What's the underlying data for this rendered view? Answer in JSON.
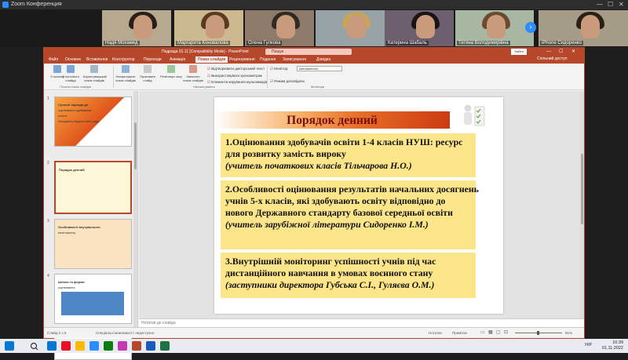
{
  "zoom": {
    "window_title": "Zoom Конференция",
    "participants": [
      {
        "name": "Надя Мохамед",
        "bg": "#b7a890",
        "hair": "#2a1e18"
      },
      {
        "name": "Маргарита Коновалова",
        "bg": "#cdb98f",
        "hair": "#5a3a22"
      },
      {
        "name": "Олена Гулкова",
        "bg": "#8d7a6a",
        "hair": "#2f2a24"
      },
      {
        "name": "",
        "bg": "#98a3a8",
        "hair": "#c8a35a"
      },
      {
        "name": "Катерина Шабаль",
        "bg": "#6c5f6e",
        "hair": "#1a1414"
      },
      {
        "name": "Тетяна Володимирівна",
        "bg": "#a7b7a1",
        "hair": "#6b4a30"
      },
      {
        "name": "iPhone Сидоренко",
        "bg": "#a49c86",
        "hair": "#2b2018"
      }
    ]
  },
  "ppt": {
    "title": "Педрада 01.11 [Compatibility Mode] - PowerPoint",
    "search_placeholder": "Пошук",
    "signin": "Увійти",
    "share": "Спільний доступ",
    "tabs": [
      "Файл",
      "Основне",
      "Вставлення",
      "Конструктор",
      "Переходи",
      "Анімація",
      "Показ слайдів",
      "Рецензування",
      "Подання",
      "Записування",
      "Довідка"
    ],
    "active_tab": "Показ слайдів",
    "ribbon": {
      "buttons": [
        "З початку",
        "З поточного слайда",
        "Користувацький показ слайдів",
        "Налаштувати показ слайдів",
        "Приховати слайд",
        "Репетиція часу",
        "Записати показ слайдів"
      ],
      "checks": [
        "Відтворювати дикторський текст",
        "Використовувати хронометраж",
        "Елементи керування мультимедіа",
        "Монітор:",
        "Режим доповідача"
      ],
      "monitor_value": "Автоматично",
      "groups": [
        "Почати показ слайдів",
        "Налаштування",
        "Монітори"
      ]
    },
    "thumbnails": [
      {
        "num": "1",
        "lines": [
          "Сучасні підходи до",
          "оцінювання здобувачів",
          "освіти",
          "Засідання педагогічної ради"
        ]
      },
      {
        "num": "2",
        "lines": [
          "Порядок денний"
        ]
      },
      {
        "num": "3",
        "lines": [
          "Особливості внутрішнього",
          "моніторингу"
        ]
      },
      {
        "num": "4",
        "lines": [
          "Шляхи та форми",
          "оцінювання"
        ]
      },
      {
        "num": "5",
        "lines": []
      }
    ],
    "slide": {
      "title": "Порядок денний",
      "items": [
        {
          "main": "1.Оцінювання здобувачів освіти 1-4 класів НУШ: ресурс для розвитку замість вироку",
          "sub": "(учитель початкових класів Тільчарова Н.О.)"
        },
        {
          "main": "2.Особливості оцінювання результатів начальних досягнень учнів 5-х класів, які здобувають освіту відповідно до нового Державного стандарту базової середньої освіти",
          "sub": "(учитель зарубіжної літератури Сидоренко І.М.)"
        },
        {
          "main": "3.Внутрішній моніторинг успішності учнів під час дистанційного навчання в умовах воєнного стану",
          "sub": "(заступники директора Губська С.І., Гуляєва О.М.)"
        }
      ]
    },
    "notes_placeholder": "Нотатки до слайда",
    "status": {
      "slide_counter": "Слайд 2 з 5",
      "accessibility": "Спеціальні можливості: недоступно",
      "notes": "Нотатки",
      "comments": "Примітки",
      "zoom": "91%"
    }
  },
  "taskbar": {
    "time": "10:39",
    "date": "01.11.2022",
    "lang": "УКР",
    "colors": [
      "#0078d4",
      "#e81123",
      "#ffb900",
      "#2d8cff",
      "#107c10",
      "#c239b3",
      "#b7472a",
      "#185abd",
      "#1e7145"
    ]
  }
}
